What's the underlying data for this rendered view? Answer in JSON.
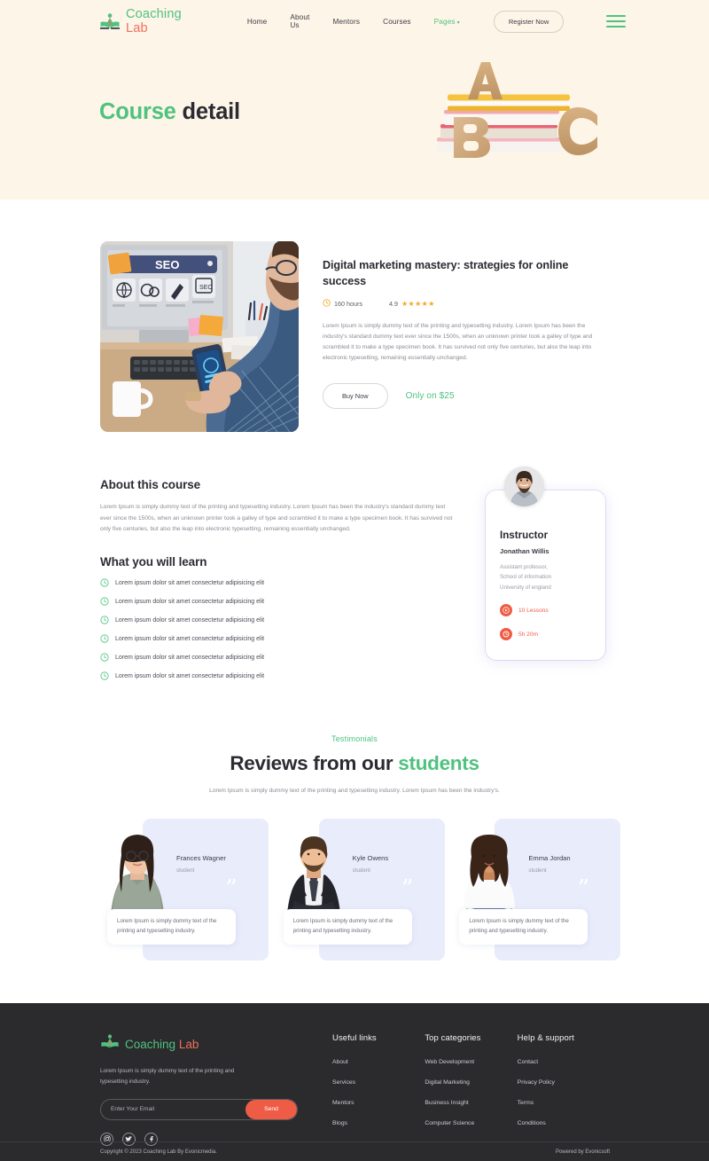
{
  "brand": {
    "name_part1": "Coaching",
    "name_part2": "Lab",
    "icon": "open-book-person-logo"
  },
  "nav": {
    "links": [
      {
        "label": "Home",
        "green": false
      },
      {
        "label": "About Us",
        "green": false
      },
      {
        "label": "Mentors",
        "green": false
      },
      {
        "label": "Courses",
        "green": false
      },
      {
        "label": "Pages",
        "green": true,
        "caret": "⌄"
      }
    ],
    "register_label": "Register Now",
    "menu_icon": "hamburger-menu-icon"
  },
  "hero": {
    "title_green": "Course",
    "title_dark": " detail",
    "art": "abc-blocks-on-books-illustration",
    "bg_color": "#fdf5e7"
  },
  "course": {
    "thumb_alt": "seo-dashboard-desk-photo",
    "title": "Digital marketing mastery: strategies for online success",
    "duration": "160 hours",
    "duration_icon": "clock-icon",
    "rating": "4.9",
    "stars": "★★★★★",
    "description": "Lorem Ipsum is simply dummy text of the printing and typesetting industry. Lorem Ipsum has been the industry's standard dummy text ever since the 1500s, when an unknown printer took a galley of type and scrambled it to make a type specimen book. It has survived not only five centuries, but also the leap into electronic typesetting, remaining essentially unchanged.",
    "buy_label": "Buy Now",
    "price_label": "Only on $25"
  },
  "about": {
    "heading": "About this course",
    "text": "Lorem Ipsum is simply dummy text of the printing and typesetting industry. Lorem Ipsum has been the industry's standard dummy text ever since the 1500s, when an unknown printer took a galley of type and scrambled it to make a type specimen book. It has survived not only five centuries, but also the leap into electronic typesetting, remaining essentially unchanged.",
    "learn_heading": "What you will learn",
    "learn_items": [
      "Lorem ipsum dolor sit amet consectetur adipisicing elit",
      "Lorem ipsum dolor sit amet consectetur adipisicing elit",
      "Lorem ipsum dolor sit amet consectetur adipisicing elit",
      "Lorem ipsum dolor sit amet consectetur adipisicing elit",
      "Lorem ipsum dolor sit amet consectetur adipisicing elit",
      "Lorem ipsum dolor sit amet consectetur adipisicing elit"
    ]
  },
  "instructor": {
    "avatar_alt": "instructor-portrait-photo",
    "heading": "Instructor",
    "name": "Jonathan Willis",
    "affiliation": "Assistant professor,\nSchool of information\nUniversity of england",
    "affiliation_lines": [
      "Assistant professor,",
      "School of information",
      "University of england"
    ],
    "lessons_label": "10 Lessons",
    "lessons_icon": "play-circle-icon",
    "duration_label": "5h 20m",
    "duration_icon": "clock-icon",
    "accent_color": "#ef5c46"
  },
  "testimonials": {
    "kicker": "Testimonials",
    "title_dark": "Reviews from our ",
    "title_green": "students",
    "subtitle": "Lorem Ipsum is simply dummy text of the printing and typesetting industry. Lorem Ipsum has been the industry's.",
    "quote_glyph": "”",
    "cards": [
      {
        "name": "Frances Wagner",
        "role": "student",
        "quote": "Lorem Ipsum is simply dummy text of the printing and typesetting industry.",
        "photo_alt": "female-student-glasses-photo"
      },
      {
        "name": "Kyle Owens",
        "role": "student",
        "quote": "Lorem Ipsum is simply dummy text of the printing and typesetting industry.",
        "photo_alt": "male-student-suit-photo"
      },
      {
        "name": "Emma Jordan",
        "role": "student",
        "quote": "Lorem Ipsum is simply dummy text of the printing and typesetting industry.",
        "photo_alt": "female-student-curly-hair-photo"
      }
    ]
  },
  "footer": {
    "brand_part1": "Coaching",
    "brand_part2": "Lab",
    "tagline": "Lorem Ipsum is simply dummy text of the printing and typesetting industry.",
    "email_placeholder": "Enter Your Email",
    "email_value": "",
    "send_label": "Send",
    "socials": [
      {
        "name": "instagram-icon"
      },
      {
        "name": "twitter-icon"
      },
      {
        "name": "facebook-icon"
      }
    ],
    "columns": [
      {
        "heading": "Useful links",
        "links": [
          "About",
          "Services",
          "Mentors",
          "Blogs"
        ]
      },
      {
        "heading": "Top categories",
        "links": [
          "Web Development",
          "Digital Marketing",
          "Business Insight",
          "Computer Science"
        ]
      },
      {
        "heading": "Help & support",
        "links": [
          "Contact",
          "Privacy Policy",
          "Terms",
          "Conditions"
        ]
      }
    ],
    "copyright": "Copyright © 2023 Coaching Lab By Evonicmedia.",
    "powered_by": "Powered by Evonicsoft"
  }
}
